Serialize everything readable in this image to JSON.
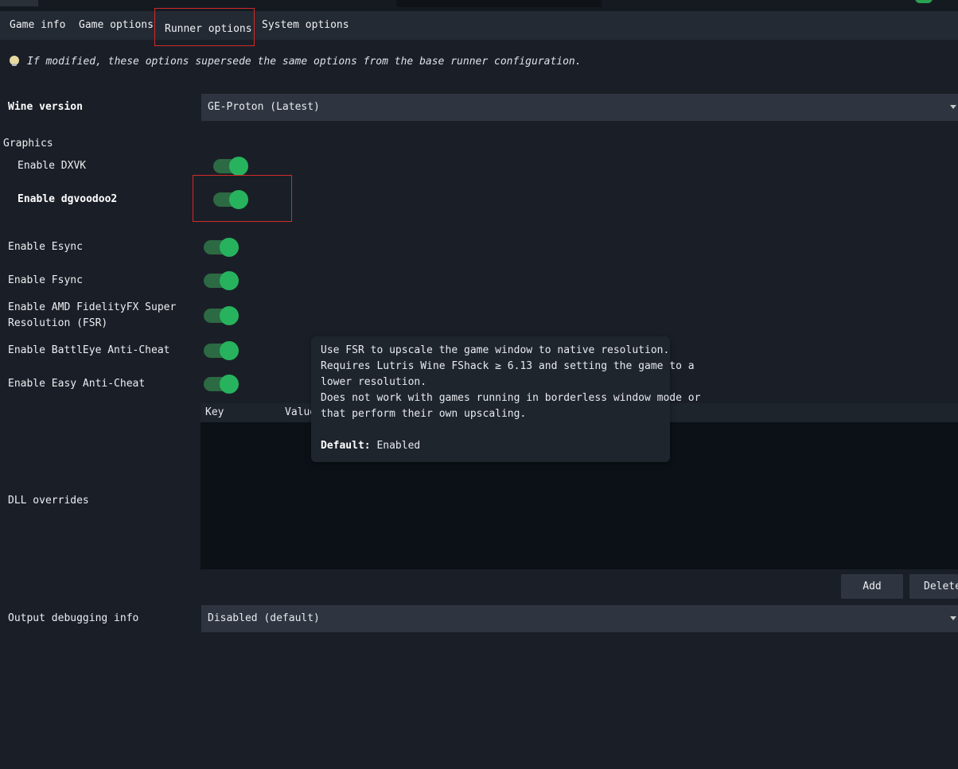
{
  "tabs": [
    {
      "label": "Game info"
    },
    {
      "label": "Game options"
    },
    {
      "label": "Runner options"
    },
    {
      "label": "System options"
    }
  ],
  "notice": "If modified, these options supersede the same options from the base runner configuration.",
  "wine_version": {
    "label": "Wine version",
    "value": "GE-Proton (Latest)"
  },
  "graphics": {
    "section_label": "Graphics",
    "dxvk": {
      "label": "Enable DXVK",
      "on": true
    },
    "dgvoodoo2": {
      "label": "Enable dgvoodoo2",
      "on": true
    }
  },
  "options": {
    "esync": {
      "label": "Enable Esync",
      "on": true
    },
    "fsync": {
      "label": "Enable Fsync",
      "on": true
    },
    "fsr": {
      "label_line1": "Enable AMD FidelityFX Super",
      "label_line2": "Resolution (FSR)",
      "on": true
    },
    "battleye": {
      "label": "Enable BattlEye Anti-Cheat",
      "on": true
    },
    "eac": {
      "label": "Enable Easy Anti-Cheat",
      "on": true
    }
  },
  "dll_overrides": {
    "label": "DLL overrides",
    "col_key": "Key",
    "col_value": "Value",
    "add_label": "Add",
    "delete_label": "Delete"
  },
  "debug": {
    "label": "Output debugging info",
    "value": "Disabled (default)"
  },
  "tooltip": {
    "line1": "Use FSR to upscale the game window to native resolution.",
    "line2": "Requires Lutris Wine FShack ≥ 6.13 and setting the game to a",
    "line3": "lower resolution.",
    "line4": "Does not work with games running in borderless window mode or",
    "line5": "that perform their own upscaling.",
    "default_label": "Default:",
    "default_value": "Enabled"
  },
  "colors": {
    "accent": "#27b35d",
    "highlight_border": "#d12a2a",
    "background": "#1a1f27"
  }
}
